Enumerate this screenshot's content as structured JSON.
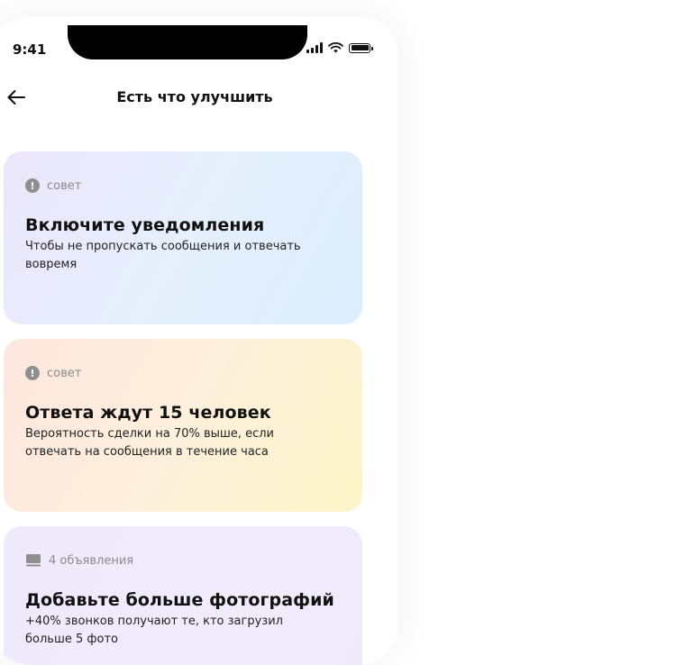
{
  "status_bar": {
    "time": "9:41",
    "icons": [
      "signal-icon",
      "wifi-icon",
      "battery-icon"
    ]
  },
  "header": {
    "back_icon": "arrow-left-icon",
    "title": "Есть что улучшить"
  },
  "cards": [
    {
      "tag_icon": "info-icon",
      "tag": "совет",
      "title": "Включите уведомления",
      "text": "Чтобы не пропускать сообщения и отвечать вовремя"
    },
    {
      "tag_icon": "info-icon",
      "tag": "совет",
      "title": "Ответа ждут 15 человек",
      "text": "Вероятность сделки на 70% выше, если отвечать на сообщения в течение часа"
    },
    {
      "tag_icon": "listing-icon",
      "tag": "4 объявления",
      "title": "Добавьте больше фотографий",
      "text": "+40% звонков получают те, кто загрузил больше 5 фото"
    }
  ],
  "colors": {
    "card_1": "#e6effc",
    "card_2": "#fdf0dc",
    "card_3": "#f1ecfc",
    "tag_text": "#8a8a8a"
  }
}
